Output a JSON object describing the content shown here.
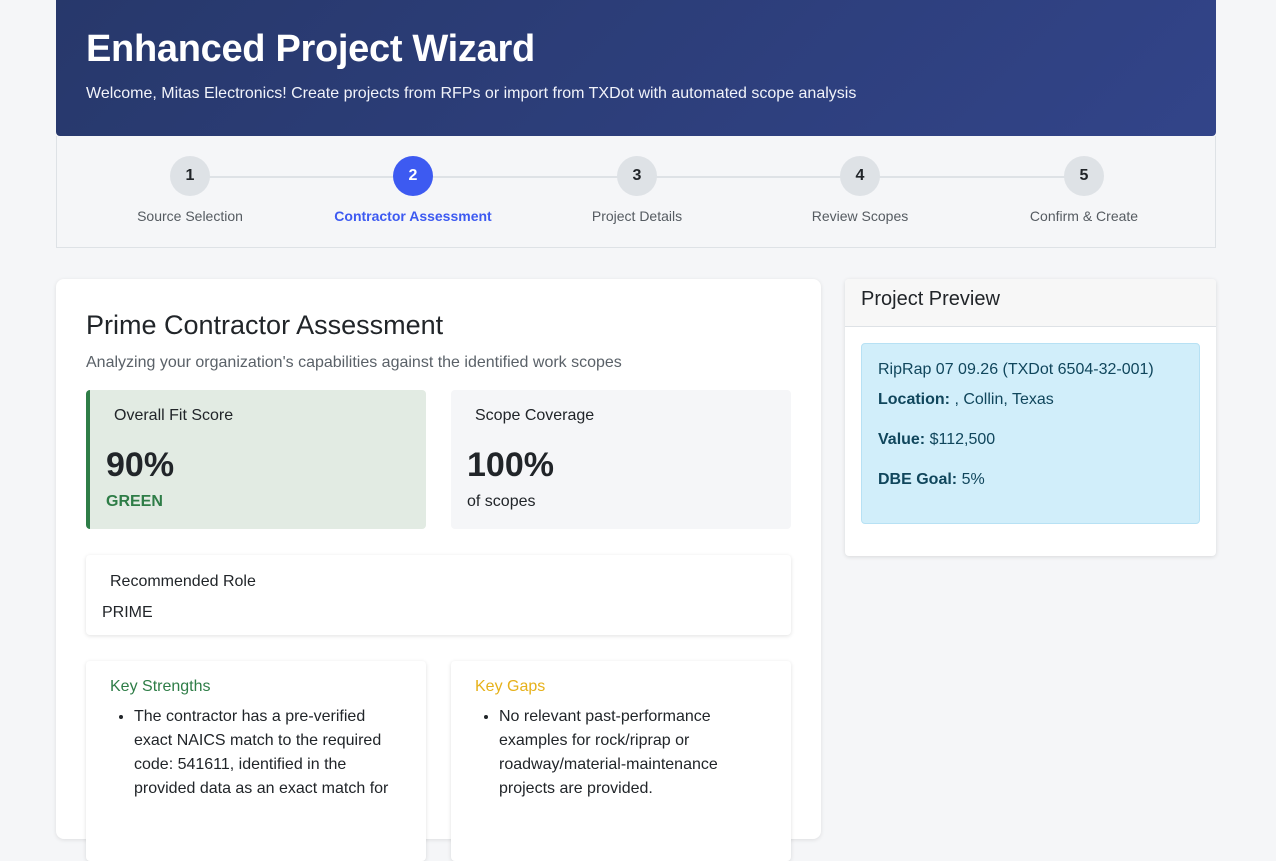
{
  "header": {
    "title": "Enhanced Project Wizard",
    "subtitle": "Welcome, Mitas Electronics! Create projects from RFPs or import from TXDot with automated scope analysis"
  },
  "stepper": {
    "steps": [
      {
        "number": "1",
        "label": "Source Selection"
      },
      {
        "number": "2",
        "label": "Contractor Assessment"
      },
      {
        "number": "3",
        "label": "Project Details"
      },
      {
        "number": "4",
        "label": "Review Scopes"
      },
      {
        "number": "5",
        "label": "Confirm & Create"
      }
    ],
    "active_step": 2
  },
  "assessment": {
    "title": "Prime Contractor Assessment",
    "subtitle": "Analyzing your organization's capabilities against the identified work scopes",
    "fit": {
      "label": "Overall Fit Score",
      "value": "90%",
      "status": "GREEN"
    },
    "coverage": {
      "label": "Scope Coverage",
      "value": "100%",
      "unit": "of scopes"
    },
    "role": {
      "label": "Recommended Role",
      "value": "PRIME"
    },
    "strengths": {
      "title": "Key Strengths",
      "items": [
        "The contractor has a pre-verified exact NAICS match to the required code: 541611, identified in the provided data as an exact match for"
      ]
    },
    "gaps": {
      "title": "Key Gaps",
      "items": [
        "No relevant past-performance examples for rock/riprap or roadway/material-maintenance projects are provided."
      ]
    }
  },
  "preview": {
    "title": "Project Preview",
    "project_name": "RipRap 07 09.26 (TXDot 6504-32-001)",
    "location_label": "Location:",
    "location_value": " , Collin, Texas",
    "value_label": "Value:",
    "value_value": " $112,500",
    "dbe_label": "DBE Goal:",
    "dbe_value": " 5%"
  },
  "colors": {
    "header_bg": "#27386b",
    "accent": "#3d5af1",
    "success": "#2e7d47",
    "warning": "#e6b11a",
    "info_bg": "#d1eefa"
  }
}
